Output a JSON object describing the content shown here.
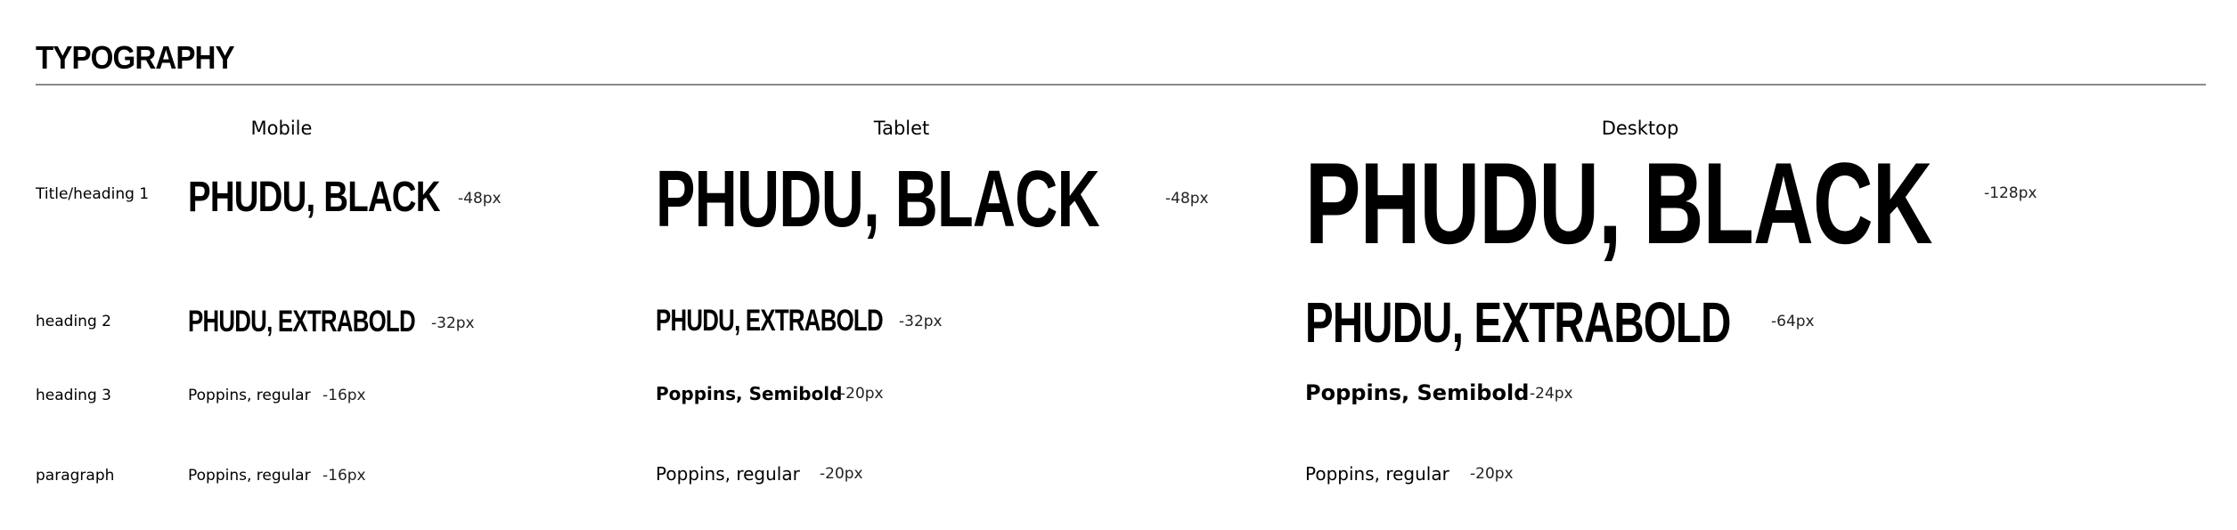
{
  "header": {
    "title": "TYPOGRAPHY"
  },
  "columns": {
    "mobile": "Mobile",
    "tablet": "Tablet",
    "desktop": "Desktop"
  },
  "rows": {
    "heading1": {
      "label": "Title/heading 1",
      "mobile": {
        "sample": "PHUDU, BLACK",
        "size": "-48px"
      },
      "tablet": {
        "sample": "PHUDU, BLACK",
        "size": "-48px"
      },
      "desktop": {
        "sample": "PHUDU, BLACK",
        "size": "-128px"
      }
    },
    "heading2": {
      "label": "heading 2",
      "mobile": {
        "sample": "PHUDU, EXTRABOLD",
        "size": "-32px"
      },
      "tablet": {
        "sample": "PHUDU, EXTRABOLD",
        "size": "-32px"
      },
      "desktop": {
        "sample": "PHUDU, EXTRABOLD",
        "size": "-64px"
      }
    },
    "heading3": {
      "label": "heading 3",
      "mobile": {
        "sample": "Poppins, regular",
        "size": "-16px"
      },
      "tablet": {
        "sample": "Poppins, Semibold",
        "size": "-20px"
      },
      "desktop": {
        "sample": "Poppins, Semibold",
        "size": "-24px"
      }
    },
    "paragraph": {
      "label": "paragraph",
      "mobile": {
        "sample": "Poppins, regular",
        "size": "-16px"
      },
      "tablet": {
        "sample": "Poppins, regular",
        "size": "-20px"
      },
      "desktop": {
        "sample": "Poppins, regular",
        "size": "-20px"
      }
    }
  },
  "colors": {
    "text": "#000000",
    "divider": "#8a8a8a",
    "background": "#ffffff"
  }
}
